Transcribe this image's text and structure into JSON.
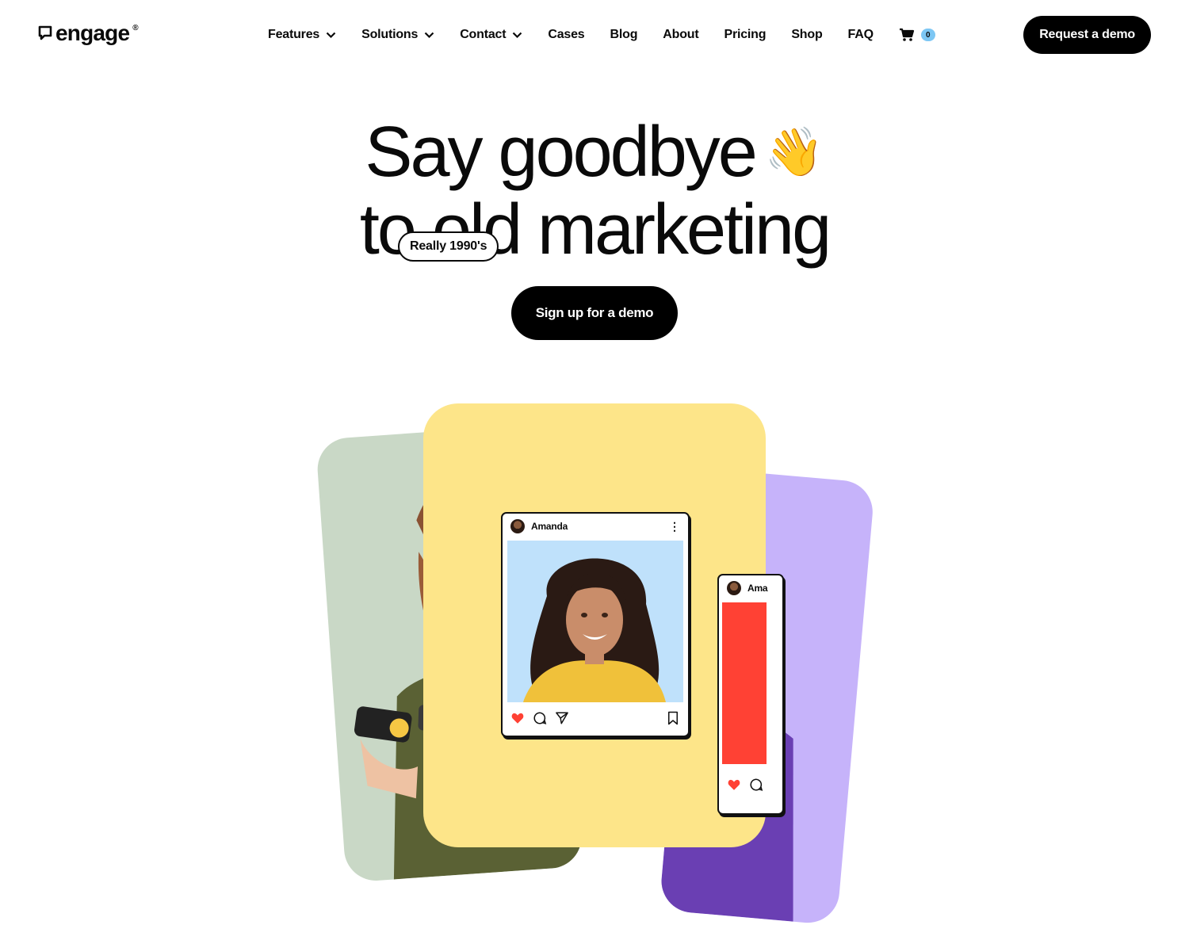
{
  "header": {
    "logo_text": "engage",
    "logo_reg": "®",
    "nav": [
      {
        "label": "Features",
        "dropdown": true
      },
      {
        "label": "Solutions",
        "dropdown": true
      },
      {
        "label": "Contact",
        "dropdown": true
      },
      {
        "label": "Cases",
        "dropdown": false
      },
      {
        "label": "Blog",
        "dropdown": false
      },
      {
        "label": "About",
        "dropdown": false
      },
      {
        "label": "Pricing",
        "dropdown": false
      },
      {
        "label": "Shop",
        "dropdown": false
      },
      {
        "label": "FAQ",
        "dropdown": false
      }
    ],
    "cart_count": "0",
    "cta_label": "Request a demo"
  },
  "hero": {
    "title_line1": "Say goodbye",
    "title_emoji": "👋",
    "title_line2": "to old marketing",
    "tag": "Really 1990's",
    "cta_label": "Sign up for a demo"
  },
  "cards": {
    "post_main_user": "Amanda",
    "post_small_user": "Ama"
  },
  "colors": {
    "accent_black": "#000000",
    "badge_blue": "#7dc7f4",
    "card_green": "#c9d8c6",
    "card_yellow": "#fde589",
    "card_purple": "#c6b3fa",
    "like_red": "#ff4134"
  }
}
